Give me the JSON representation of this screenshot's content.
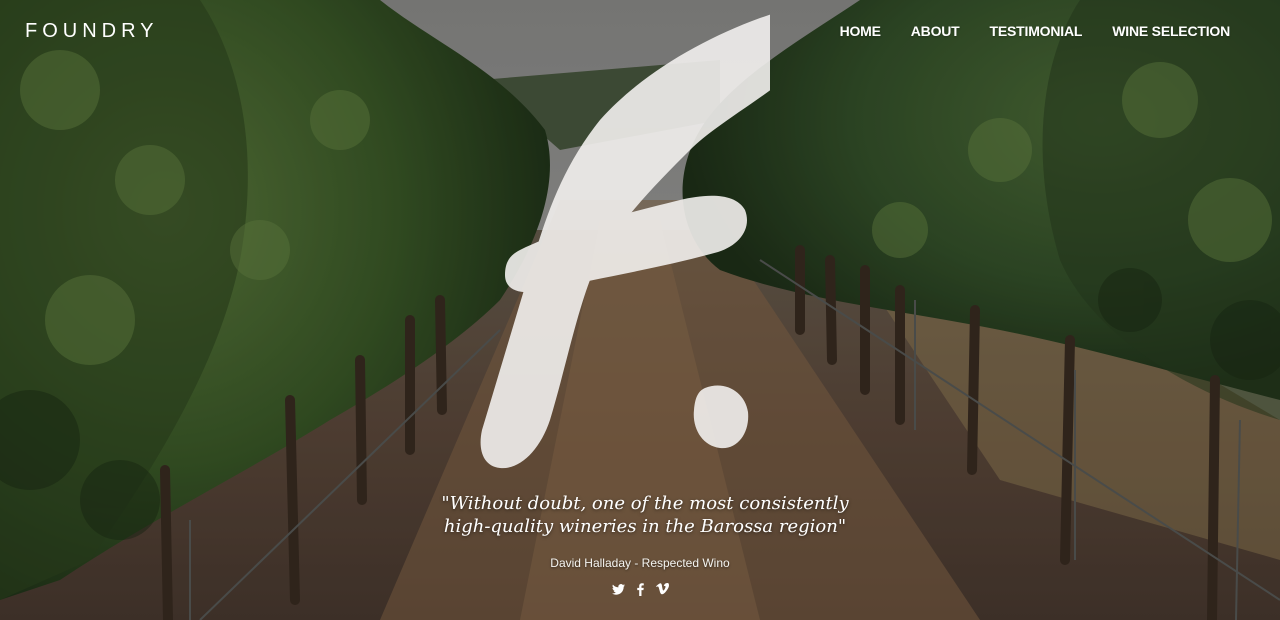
{
  "brand": {
    "name": "FOUNDRY"
  },
  "nav": {
    "items": [
      {
        "label": "HOME"
      },
      {
        "label": "ABOUT"
      },
      {
        "label": "TESTIMONIAL"
      },
      {
        "label": "WINE SELECTION"
      }
    ]
  },
  "testimonial": {
    "quote_line1": "\"Without doubt, one of the most consistently",
    "quote_line2": "high-quality wineries in the Barossa region\"",
    "attribution": "David Halladay - Respected Wino"
  },
  "social": {
    "icons": [
      "twitter-icon",
      "facebook-icon",
      "vimeo-icon"
    ]
  },
  "colors": {
    "text": "#ffffff",
    "foliage": "#3e5a2a",
    "soil": "#5a4a3a",
    "sky": "#9a9a98"
  }
}
